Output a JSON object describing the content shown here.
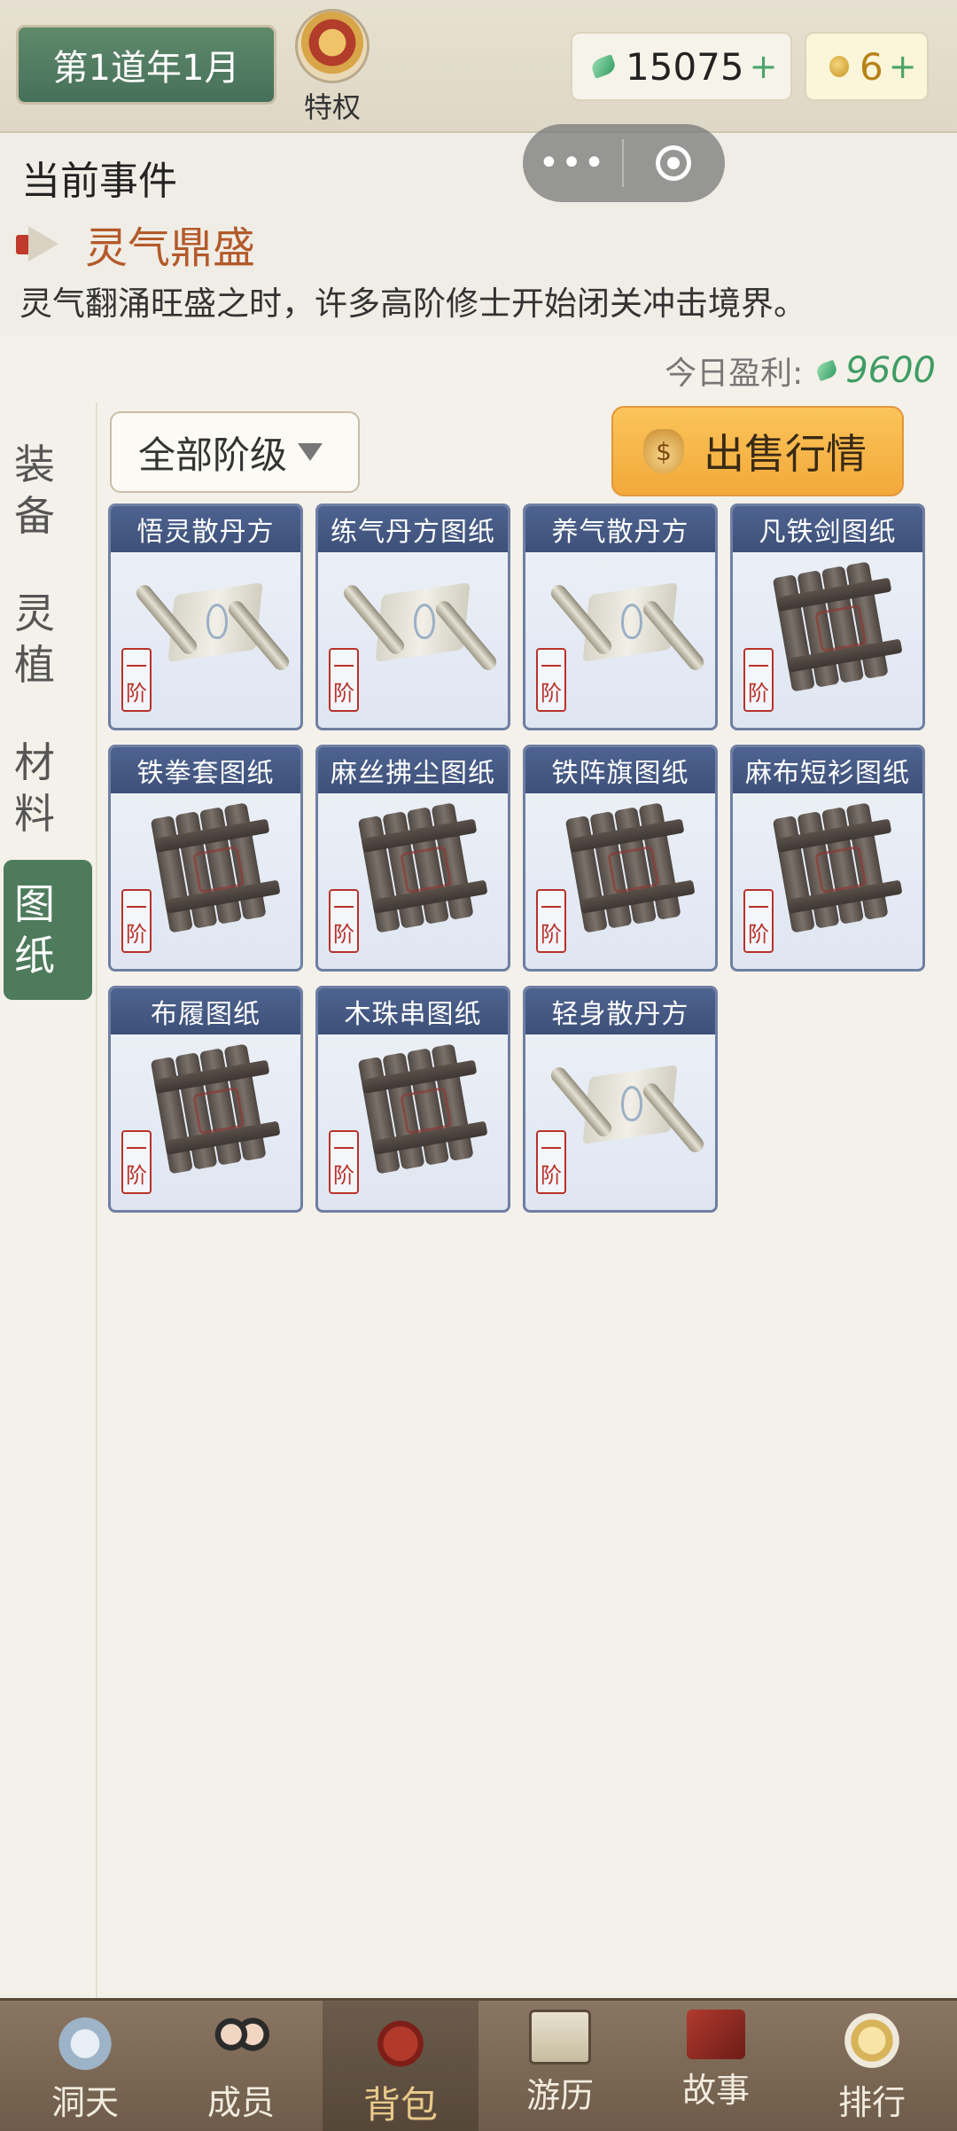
{
  "header": {
    "date": "第1道年1月",
    "privilege_label": "特权",
    "jade_amount": "15075",
    "coin_amount": "6",
    "plus": "+"
  },
  "capsule": {
    "more": "•••"
  },
  "event": {
    "heading": "当前事件",
    "name": "灵气鼎盛",
    "description": "灵气翻涌旺盛之时，许多高阶修士开始闭关冲击境界。"
  },
  "profit": {
    "label": "今日盈利:",
    "value": "9600"
  },
  "sidebar": {
    "tabs": [
      {
        "label": "装\n备",
        "active": false
      },
      {
        "label": "灵\n植",
        "active": false
      },
      {
        "label": "材\n料",
        "active": false
      },
      {
        "label": "图\n纸",
        "active": true
      }
    ]
  },
  "filter": {
    "label": "全部阶级"
  },
  "sell_button": {
    "label": "出售行情",
    "icon_text": "$"
  },
  "items": [
    {
      "name": "悟灵散丹方",
      "tier": "一\n阶",
      "kind": "scroll"
    },
    {
      "name": "练气丹方图纸",
      "tier": "一\n阶",
      "kind": "scroll"
    },
    {
      "name": "养气散丹方",
      "tier": "一\n阶",
      "kind": "scroll"
    },
    {
      "name": "凡铁剑图纸",
      "tier": "一\n阶",
      "kind": "plank"
    },
    {
      "name": "铁拳套图纸",
      "tier": "一\n阶",
      "kind": "plank"
    },
    {
      "name": "麻丝拂尘图纸",
      "tier": "一\n阶",
      "kind": "plank"
    },
    {
      "name": "铁阵旗图纸",
      "tier": "一\n阶",
      "kind": "plank"
    },
    {
      "name": "麻布短衫图纸",
      "tier": "一\n阶",
      "kind": "plank"
    },
    {
      "name": "布履图纸",
      "tier": "一\n阶",
      "kind": "plank"
    },
    {
      "name": "木珠串图纸",
      "tier": "一\n阶",
      "kind": "plank"
    },
    {
      "name": "轻身散丹方",
      "tier": "一\n阶",
      "kind": "scroll"
    }
  ],
  "bottom_nav": [
    {
      "label": "洞天",
      "icon": "cave-icon",
      "active": false
    },
    {
      "label": "成员",
      "icon": "members-icon",
      "active": false
    },
    {
      "label": "背包",
      "icon": "bag-icon",
      "active": true
    },
    {
      "label": "游历",
      "icon": "travel-map-icon",
      "active": false
    },
    {
      "label": "故事",
      "icon": "story-book-icon",
      "active": false
    },
    {
      "label": "排行",
      "icon": "rank-icon",
      "active": false
    }
  ]
}
